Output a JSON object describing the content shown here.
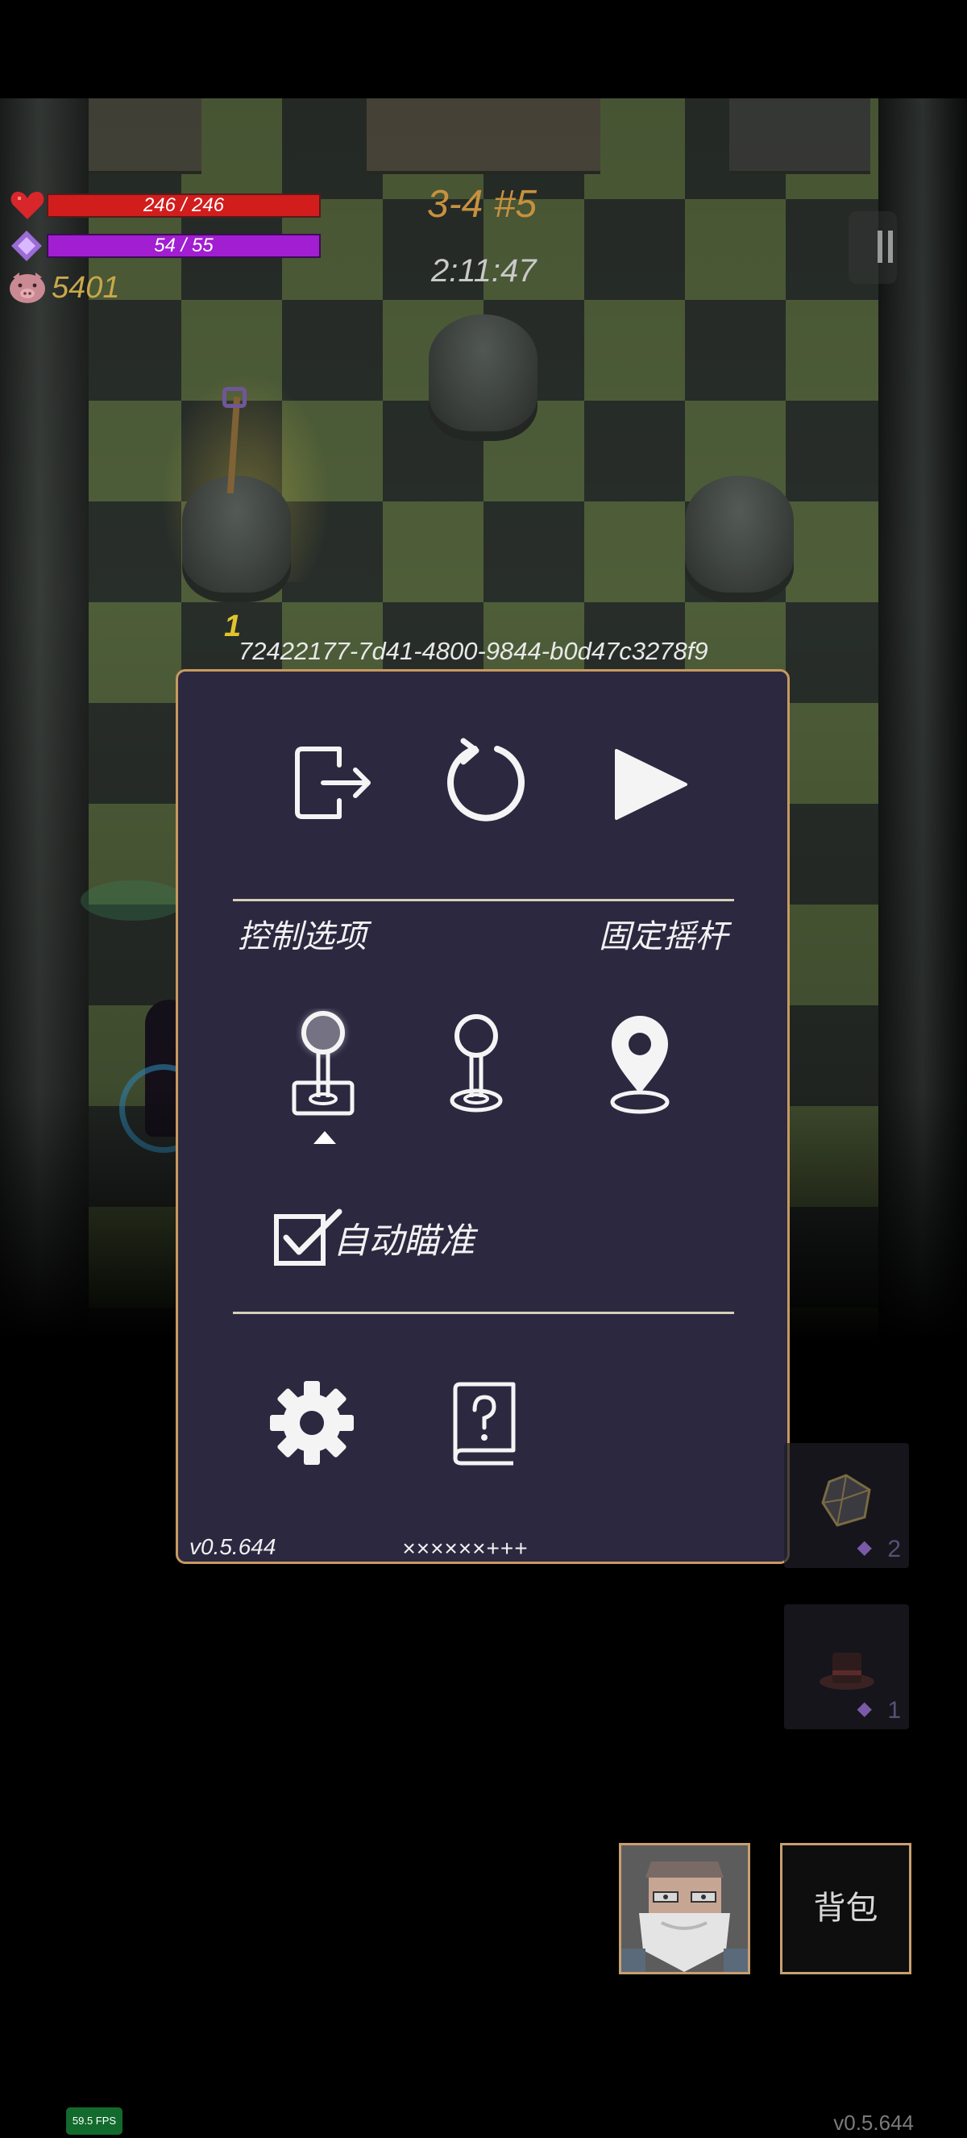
{
  "hud": {
    "hp": "246 / 246",
    "mp": "54 / 55",
    "coins": "5401",
    "stage": "3-4 #5",
    "timer": "2:11:47",
    "hp_color": "#d21d1d",
    "mp_color": "#a11ed1",
    "icons": [
      "heart-icon",
      "mana-gem-icon",
      "pig-coin-icon",
      "pause-icon"
    ]
  },
  "scene": {
    "floor_marker": "1",
    "session_id": "72422177-7d41-4800-9844-b0d47c3278f9"
  },
  "menu": {
    "top_actions": [
      "exit-icon",
      "restart-icon",
      "resume-icon"
    ],
    "control_options_label": "控制选项",
    "control_mode_value": "固定摇杆",
    "control_modes": [
      "fixed-joystick-icon",
      "floating-joystick-icon",
      "location-pin-joystick-icon"
    ],
    "selected_mode_index": 0,
    "auto_aim_label": "自动瞄准",
    "auto_aim_checked": true,
    "bottom_actions": [
      "settings-gear-icon",
      "help-book-icon"
    ],
    "version": "v0.5.644",
    "code": "××××××+++",
    "border_color": "#c79a5e",
    "background_color": "#2b2840"
  },
  "side_slots": [
    {
      "icon": "dice-icon",
      "count": "2"
    },
    {
      "icon": "hat-icon",
      "count": "1"
    }
  ],
  "bottom": {
    "portrait_icon": "old-wizard-portrait-icon",
    "bag_label": "背包",
    "fps": "59.5 FPS",
    "version": "v0.5.644"
  }
}
